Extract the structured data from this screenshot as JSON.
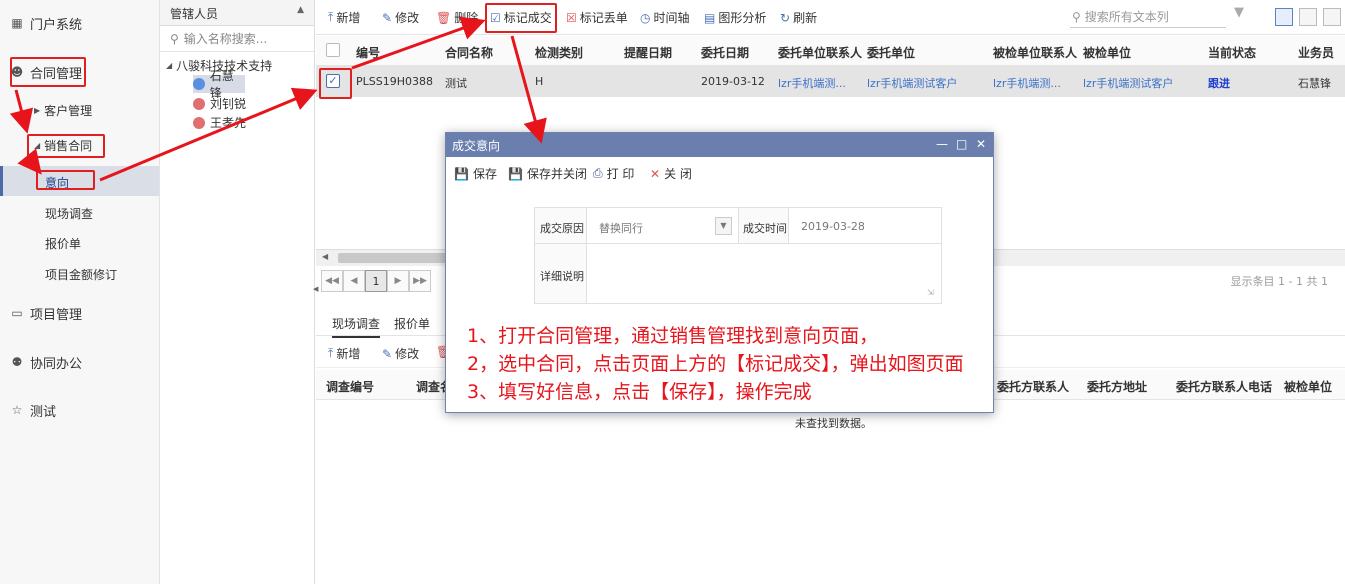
{
  "sidebar": {
    "items": [
      {
        "label": "门户系统",
        "icon": "grid-icon"
      },
      {
        "label": "合同管理",
        "icon": "user-icon"
      },
      {
        "label": "客户管理"
      },
      {
        "label": "销售合同"
      },
      {
        "label": "意向"
      },
      {
        "label": "现场调查"
      },
      {
        "label": "报价单"
      },
      {
        "label": "项目金额修订"
      },
      {
        "label": "项目管理",
        "icon": "monitor-icon"
      },
      {
        "label": "协同办公",
        "icon": "person-icon"
      },
      {
        "label": "测试",
        "icon": "star-icon"
      }
    ]
  },
  "tree": {
    "header": "管辖人员",
    "search_placeholder": "输入名称搜索...",
    "root": "八骏科技技术支持",
    "people": [
      "石慧锋",
      "刘钊锐",
      "王孝先"
    ]
  },
  "toolbar": {
    "items": [
      "新增",
      "修改",
      "删除",
      "标记成交",
      "标记丢单",
      "时间轴",
      "图形分析",
      "刷新"
    ],
    "search_placeholder": "搜索所有文本列"
  },
  "grid": {
    "columns": [
      "编号",
      "合同名称",
      "检测类别",
      "提醒日期",
      "委托日期",
      "委托单位联系人",
      "委托单位",
      "被检单位联系人",
      "被检单位",
      "当前状态",
      "业务员"
    ],
    "row": {
      "id": "PLSS19H0388",
      "name": "测试",
      "category": "H",
      "remind_date": "",
      "entrust_date": "2019-03-12",
      "entrust_contact": "lzr手机端测...",
      "entrust_unit": "lzr手机端测试客户",
      "inspected_contact": "lzr手机端测...",
      "inspected_unit": "lzr手机端测试客户",
      "status": "跟进",
      "salesman": "石慧锋"
    }
  },
  "pager": {
    "current": "1",
    "info": "显示条目 1 - 1 共 1"
  },
  "subtabs": [
    "现场调查",
    "报价单"
  ],
  "sub_toolbar": [
    "新增",
    "修改"
  ],
  "sub_grid": {
    "columns_left": [
      "调查编号",
      "调查名"
    ],
    "columns_right": [
      "委托方联系人",
      "委托方地址",
      "委托方联系人电话",
      "被检单位"
    ],
    "empty": "未查找到数据。"
  },
  "dialog": {
    "title": "成交意向",
    "toolbar": [
      "保存",
      "保存并关闭",
      "打 印",
      "关 闭"
    ],
    "reason_label": "成交原因",
    "reason_value": "替换同行",
    "time_label": "成交时间",
    "time_value": "2019-03-28",
    "detail_label": "详细说明"
  },
  "notes": [
    "1、打开合同管理，通过销售管理找到意向页面，",
    "2，选中合同，点击页面上方的【标记成交】，弹出如图页面",
    "3、填写好信息，点击【保存】，操作完成"
  ],
  "colors": {
    "annotation": "#e8141b",
    "dialog_title": "#6b7fae",
    "selected_row": "#e4e4e4",
    "status": "#1f3fcf"
  }
}
